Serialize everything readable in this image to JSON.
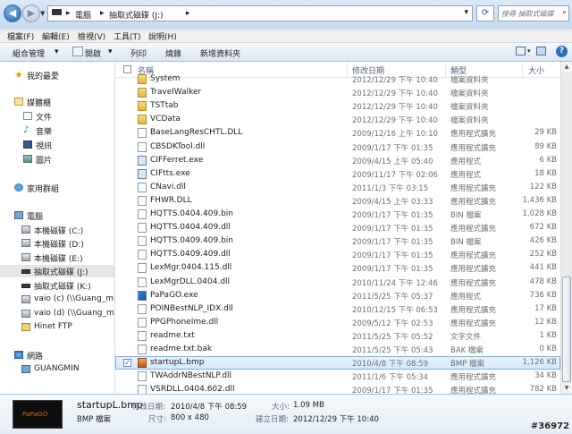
{
  "address": {
    "segments": [
      "電腦",
      "抽取式磁碟 (J:)"
    ],
    "separator": "▸",
    "dropdown_glyph": "▾",
    "refresh_glyph": "⟳",
    "search_placeholder": "搜尋 抽取式磁碟"
  },
  "menu": [
    "檔案(F)",
    "編輯(E)",
    "檢視(V)",
    "工具(T)",
    "說明(H)"
  ],
  "toolbar": {
    "organize": "組合管理",
    "open": "開啟",
    "print": "列印",
    "burn": "燒錄",
    "new_folder": "新增資料夾",
    "arrow": "▾"
  },
  "nav": [
    {
      "label": "我的最愛",
      "icon": "star-icon"
    },
    {
      "label": "媒體櫃",
      "icon": "library-icon"
    },
    {
      "label": "文件",
      "icon": "documents-icon"
    },
    {
      "label": "音樂",
      "icon": "music-icon"
    },
    {
      "label": "視訊",
      "icon": "video-icon"
    },
    {
      "label": "圖片",
      "icon": "pictures-icon"
    },
    {
      "label": "家用群組",
      "icon": "homegroup-icon"
    },
    {
      "label": "電腦",
      "icon": "computer-icon"
    },
    {
      "label": "本機磁碟 (C:)",
      "icon": "drive-icon"
    },
    {
      "label": "本機磁碟 (D:)",
      "icon": "drive-icon"
    },
    {
      "label": "本機磁碟 (E:)",
      "icon": "drive-icon"
    },
    {
      "label": "抽取式磁碟 (J:)",
      "icon": "removable-drive-icon",
      "selected": true
    },
    {
      "label": "抽取式磁碟 (K:)",
      "icon": "removable-drive-icon"
    },
    {
      "label": "vaio (c) (\\\\Guang_min_",
      "icon": "network-drive-icon"
    },
    {
      "label": "vaio (d) (\\\\Guang_min_",
      "icon": "network-drive-icon"
    },
    {
      "label": "Hinet FTP",
      "icon": "ftp-icon"
    },
    {
      "label": "網路",
      "icon": "network-icon"
    },
    {
      "label": "GUANGMIN",
      "icon": "computer-icon"
    }
  ],
  "columns": {
    "name": "名稱",
    "date": "修改日期",
    "type": "類型",
    "size": "大小"
  },
  "files": [
    {
      "name": "System",
      "date": "2012/12/29 下午 10:40",
      "type": "檔案資料夾",
      "size": "",
      "icon": "folder-icon"
    },
    {
      "name": "TravelWalker",
      "date": "2012/12/29 下午 10:40",
      "type": "檔案資料夾",
      "size": "",
      "icon": "folder-icon"
    },
    {
      "name": "TSTtab",
      "date": "2012/12/29 下午 10:40",
      "type": "檔案資料夾",
      "size": "",
      "icon": "folder-icon"
    },
    {
      "name": "VCData",
      "date": "2012/12/29 下午 10:40",
      "type": "檔案資料夾",
      "size": "",
      "icon": "folder-icon"
    },
    {
      "name": "BaseLangResCHTL.DLL",
      "date": "2009/12/16 上午 10:10",
      "type": "應用程式擴充",
      "size": "29 KB",
      "icon": "file-icon"
    },
    {
      "name": "CBSDKTool.dll",
      "date": "2009/1/17 下午 01:35",
      "type": "應用程式擴充",
      "size": "89 KB",
      "icon": "file-icon"
    },
    {
      "name": "CIFFerret.exe",
      "date": "2009/4/15 上午 05:40",
      "type": "應用程式",
      "size": "6 KB",
      "icon": "exe-icon"
    },
    {
      "name": "CIFtts.exe",
      "date": "2009/11/17 下午 02:06",
      "type": "應用程式",
      "size": "18 KB",
      "icon": "exe-icon"
    },
    {
      "name": "CNavi.dll",
      "date": "2011/1/3 下午 03:15",
      "type": "應用程式擴充",
      "size": "122 KB",
      "icon": "file-icon"
    },
    {
      "name": "FHWR.DLL",
      "date": "2009/4/15 上午 03:33",
      "type": "應用程式擴充",
      "size": "1,436 KB",
      "icon": "file-icon"
    },
    {
      "name": "HQTTS.0404.409.bin",
      "date": "2009/1/17 下午 01:35",
      "type": "BIN 檔案",
      "size": "1,028 KB",
      "icon": "file-icon"
    },
    {
      "name": "HQTTS.0404.409.dll",
      "date": "2009/1/17 下午 01:35",
      "type": "應用程式擴充",
      "size": "672 KB",
      "icon": "file-icon"
    },
    {
      "name": "HQTTS.0409.409.bin",
      "date": "2009/1/17 下午 01:35",
      "type": "BIN 檔案",
      "size": "426 KB",
      "icon": "file-icon"
    },
    {
      "name": "HQTTS.0409.409.dll",
      "date": "2009/1/17 下午 01:35",
      "type": "應用程式擴充",
      "size": "252 KB",
      "icon": "file-icon"
    },
    {
      "name": "LexMgr.0404.115.dll",
      "date": "2009/1/17 下午 01:35",
      "type": "應用程式擴充",
      "size": "441 KB",
      "icon": "file-icon"
    },
    {
      "name": "LexMgrDLL.0404.dll",
      "date": "2010/11/24 下午 12:46",
      "type": "應用程式擴充",
      "size": "478 KB",
      "icon": "file-icon"
    },
    {
      "name": "PaPaGO.exe",
      "date": "2011/5/25 下午 05:37",
      "type": "應用程式",
      "size": "736 KB",
      "icon": "papago-icon"
    },
    {
      "name": "POINBestNLP_IDX.dll",
      "date": "2010/12/15 下午 06:53",
      "type": "應用程式擴充",
      "size": "17 KB",
      "icon": "file-icon"
    },
    {
      "name": "PPGPhoneIme.dll",
      "date": "2009/5/12 下午 02:53",
      "type": "應用程式擴充",
      "size": "12 KB",
      "icon": "file-icon"
    },
    {
      "name": "readme.txt",
      "date": "2011/5/25 下午 05:52",
      "type": "文字文件",
      "size": "1 KB",
      "icon": "txt-icon"
    },
    {
      "name": "readme.txt.bak",
      "date": "2011/5/25 下午 05:43",
      "type": "BAK 檔案",
      "size": "0 KB",
      "icon": "file-icon"
    },
    {
      "name": "startupL.bmp",
      "date": "2010/4/8 下午 08:59",
      "type": "BMP 檔案",
      "size": "1,126 KB",
      "icon": "bmp-icon",
      "selected": true
    },
    {
      "name": "TWAddrNBestNLP.dll",
      "date": "2011/1/6 下午 05:34",
      "type": "應用程式擴充",
      "size": "34 KB",
      "icon": "file-icon"
    },
    {
      "name": "VSRDLL.0404.602.dll",
      "date": "2009/1/17 下午 01:35",
      "type": "應用程式擴充",
      "size": "782 KB",
      "icon": "file-icon"
    }
  ],
  "details": {
    "thumb_text": "PaPaGO",
    "filename": "startupL.bmp",
    "filetype": "BMP 檔案",
    "modified_label": "修改日期:",
    "modified_value": "2010/4/8 下午 08:59",
    "size_label": "大小:",
    "size_value": "1.09 MB",
    "dimensions_label": "尺寸:",
    "dimensions_value": "800 x 480",
    "created_label": "建立日期:",
    "created_value": "2012/12/29 下午 10:40"
  },
  "watermark": "#36972",
  "colors": {
    "accent": "#2f6fbc",
    "selection": "#d4e8fa",
    "folder": "#e3b446"
  }
}
